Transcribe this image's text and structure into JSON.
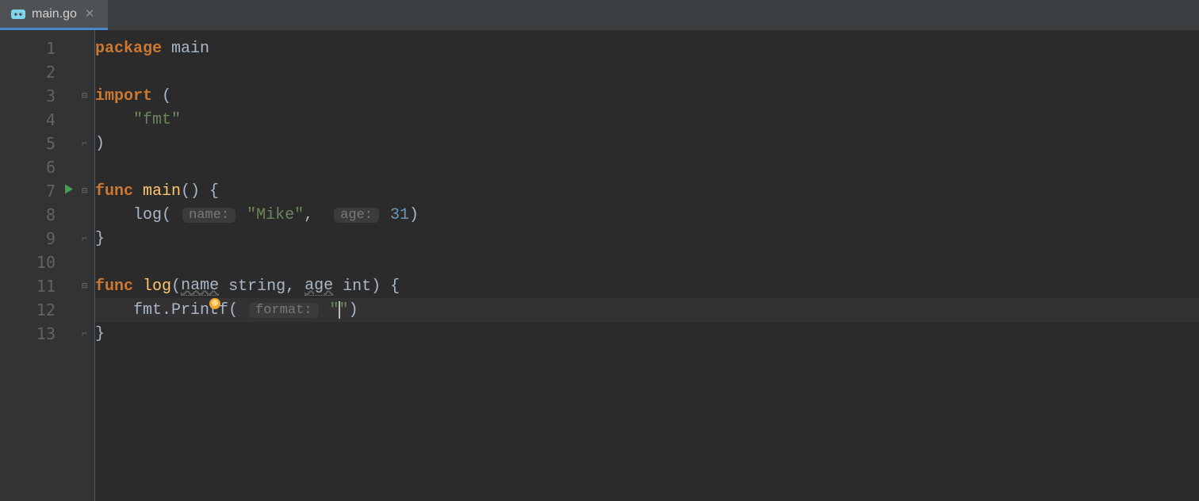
{
  "tab": {
    "filename": "main.go",
    "icon": "go-file-icon"
  },
  "lines": {
    "count": 13,
    "numbers": [
      "1",
      "2",
      "3",
      "4",
      "5",
      "6",
      "7",
      "8",
      "9",
      "10",
      "11",
      "12",
      "13"
    ]
  },
  "code": {
    "l1_kw": "package",
    "l1_name": "main",
    "l3_kw": "import",
    "l3_open": "(",
    "l4_str": "\"fmt\"",
    "l5_close": ")",
    "l7_kw": "func",
    "l7_name": "main",
    "l7_sig": "() {",
    "l8_call": "log",
    "l8_open": "(",
    "l8_hint1": "name:",
    "l8_arg1": "\"Mike\"",
    "l8_comma": ",",
    "l8_hint2": "age:",
    "l8_arg2": "31",
    "l8_close": ")",
    "l9_close": "}",
    "l11_kw": "func",
    "l11_name": "log",
    "l11_open": "(",
    "l11_p1": "name",
    "l11_t1": "string",
    "l11_p2": "age",
    "l11_t2": "int",
    "l11_sig_close": ") {",
    "l12_recv": "fmt",
    "l12_dot": ".",
    "l12_call": "Printf",
    "l12_open": "(",
    "l12_hint": "format:",
    "l12_str_open": "\"",
    "l12_str_close": "\"",
    "l12_close": ")",
    "l13_close": "}"
  }
}
